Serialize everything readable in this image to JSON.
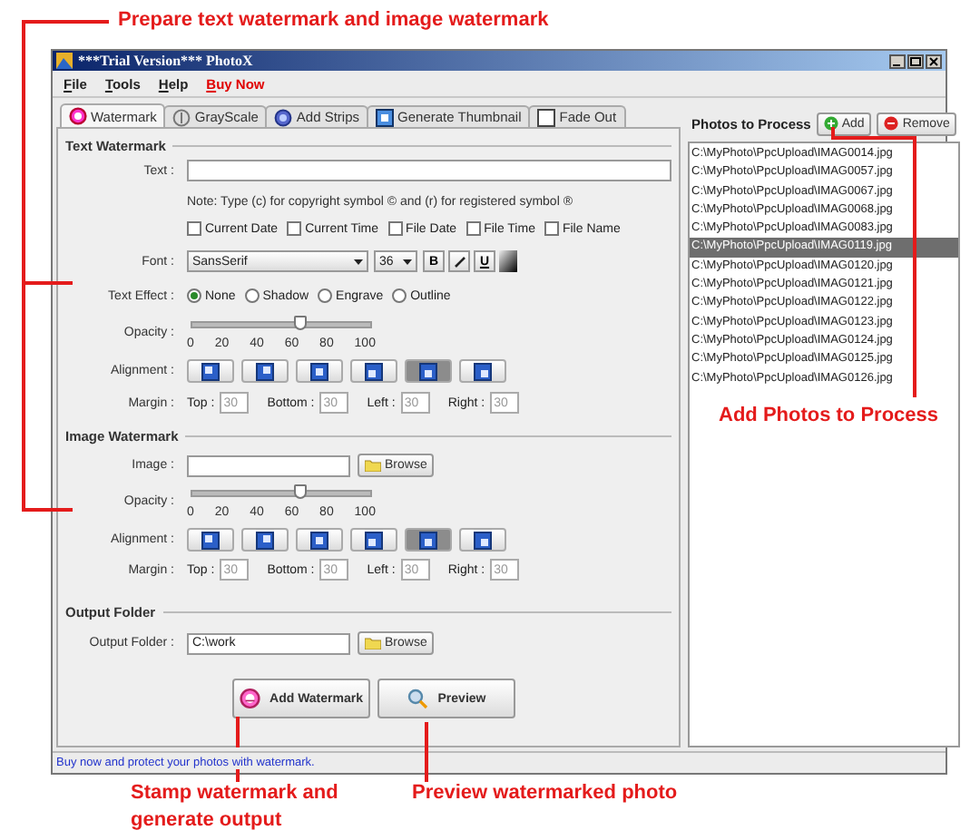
{
  "annotations": [
    {
      "text": "Prepare text watermark and image watermark"
    },
    {
      "text": "Add Photos to Process"
    },
    {
      "text": "Stamp watermark and generate output"
    },
    {
      "text": "Preview watermarked photo"
    }
  ],
  "window": {
    "title": "***Trial Version*** PhotoX"
  },
  "menu": [
    {
      "label": "File",
      "kind": "normal"
    },
    {
      "label": "Tools",
      "kind": "normal"
    },
    {
      "label": "Help",
      "kind": "normal"
    },
    {
      "label": "Buy Now",
      "kind": "promo"
    }
  ],
  "tabs": [
    {
      "label": "Watermark",
      "kind": "stamp",
      "selected": true
    },
    {
      "label": "GrayScale",
      "kind": "gray",
      "selected": false
    },
    {
      "label": "Add Strips",
      "kind": "strips",
      "selected": false
    },
    {
      "label": "Generate Thumbnail",
      "kind": "thumbnail",
      "selected": false
    },
    {
      "label": "Fade Out",
      "kind": "fade",
      "selected": false
    }
  ],
  "text_watermark": {
    "title": "Text Watermark",
    "text_label": "Text :",
    "note": "Note: Type (c) for copyright symbol © and (r) for registered symbol ®",
    "options": [
      {
        "label": "Current Date",
        "checked": false
      },
      {
        "label": "Current Time",
        "checked": false
      },
      {
        "label": "File Date",
        "checked": false
      },
      {
        "label": "File Time",
        "checked": false
      },
      {
        "label": "File Name",
        "checked": false
      }
    ],
    "font_label": "Font :",
    "font": "SansSerif",
    "size": "36",
    "style_buttons": [
      {
        "kind": "bold",
        "label": "B"
      },
      {
        "kind": "italic"
      },
      {
        "kind": "underline",
        "label": "U"
      },
      {
        "kind": "color"
      }
    ],
    "effect_label": "Text Effect :",
    "effects": [
      {
        "label": "None",
        "selected": true
      },
      {
        "label": "Shadow",
        "selected": false
      },
      {
        "label": "Engrave",
        "selected": false
      },
      {
        "label": "Outline",
        "selected": false
      }
    ],
    "opacity_label": "Opacity :",
    "opacity": {
      "level": 0.6
    },
    "ticks": [
      "0",
      "20",
      "40",
      "60",
      "80",
      "100"
    ],
    "alignment_label": "Alignment :",
    "alignments": [
      {
        "selected": false
      },
      {
        "selected": false
      },
      {
        "selected": false
      },
      {
        "selected": false
      },
      {
        "selected": true
      },
      {
        "selected": false
      }
    ],
    "margin_label": "Margin :",
    "margins": [
      {
        "label": "Top :",
        "value": "30",
        "disabled": true
      },
      {
        "label": "Bottom :",
        "value": "30",
        "disabled": true
      },
      {
        "label": "Left :",
        "value": "30",
        "disabled": true
      },
      {
        "label": "Right :",
        "value": "30",
        "disabled": true
      }
    ]
  },
  "image_watermark": {
    "title": "Image Watermark",
    "image_label": "Image :",
    "browse": "Browse",
    "opacity_label": "Opacity :",
    "opacity": {
      "level": 0.6
    },
    "ticks": [
      "0",
      "20",
      "40",
      "60",
      "80",
      "100"
    ],
    "alignment_label": "Alignment :",
    "alignments": [
      {
        "selected": false
      },
      {
        "selected": false
      },
      {
        "selected": false
      },
      {
        "selected": false
      },
      {
        "selected": true
      },
      {
        "selected": false
      }
    ],
    "margin_label": "Margin :",
    "margins": [
      {
        "label": "Top :",
        "value": "30",
        "disabled": true
      },
      {
        "label": "Bottom :",
        "value": "30",
        "disabled": true
      },
      {
        "label": "Left :",
        "value": "30",
        "disabled": true
      },
      {
        "label": "Right :",
        "value": "30",
        "disabled": true
      }
    ]
  },
  "output_folder": {
    "title": "Output Folder",
    "label": "Output Folder :",
    "value": "C:\\work",
    "browse": "Browse"
  },
  "actions": [
    {
      "label": "Add Watermark",
      "kind": "stamp"
    },
    {
      "label": "Preview",
      "kind": "preview"
    }
  ],
  "photos": {
    "title": "Photos to Process",
    "add": "Add",
    "remove": "Remove",
    "files": [
      {
        "name": "C:\\MyPhoto\\PpcUpload\\IMAG0014.jpg",
        "selected": false
      },
      {
        "name": "C:\\MyPhoto\\PpcUpload\\IMAG0057.jpg",
        "selected": false
      },
      {
        "name": "C:\\MyPhoto\\PpcUpload\\IMAG0067.jpg",
        "selected": false
      },
      {
        "name": "C:\\MyPhoto\\PpcUpload\\IMAG0068.jpg",
        "selected": false
      },
      {
        "name": "C:\\MyPhoto\\PpcUpload\\IMAG0083.jpg",
        "selected": false
      },
      {
        "name": "C:\\MyPhoto\\PpcUpload\\IMAG0119.jpg",
        "selected": true
      },
      {
        "name": "C:\\MyPhoto\\PpcUpload\\IMAG0120.jpg",
        "selected": false
      },
      {
        "name": "C:\\MyPhoto\\PpcUpload\\IMAG0121.jpg",
        "selected": false
      },
      {
        "name": "C:\\MyPhoto\\PpcUpload\\IMAG0122.jpg",
        "selected": false
      },
      {
        "name": "C:\\MyPhoto\\PpcUpload\\IMAG0123.jpg",
        "selected": false
      },
      {
        "name": "C:\\MyPhoto\\PpcUpload\\IMAG0124.jpg",
        "selected": false
      },
      {
        "name": "C:\\MyPhoto\\PpcUpload\\IMAG0125.jpg",
        "selected": false
      },
      {
        "name": "C:\\MyPhoto\\PpcUpload\\IMAG0126.jpg",
        "selected": false
      }
    ]
  },
  "status_bar": {
    "text": "Buy now and protect your photos with watermark."
  }
}
